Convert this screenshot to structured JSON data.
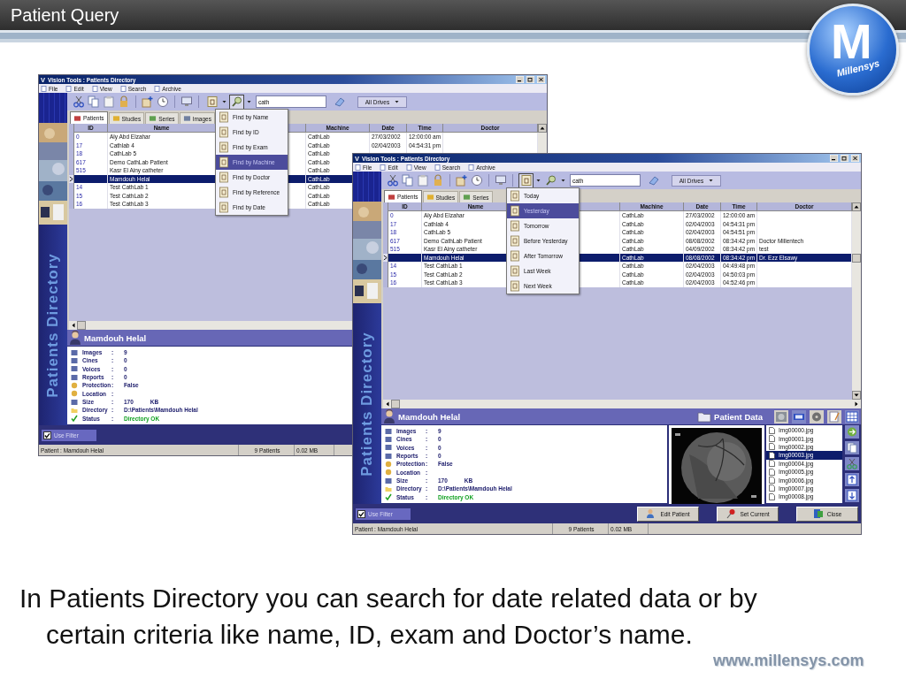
{
  "slide": {
    "title": "Patient Query",
    "logo": {
      "letter": "M",
      "name": "Millensys"
    }
  },
  "windows": [
    {
      "title": "Vision Tools : Patients Directory",
      "app_letter": "V",
      "menu": [
        "File",
        "Edit",
        "View",
        "Search",
        "Archive"
      ],
      "search_value": "cath",
      "drive": "All Drives",
      "tabs": [
        {
          "label": "Patients",
          "selected": true
        },
        {
          "label": "Studies",
          "selected": false
        },
        {
          "label": "Series",
          "selected": false
        },
        {
          "label": "Images",
          "selected": false
        }
      ],
      "sidebar_label": "Patients Directory",
      "columns": [
        "ID",
        "Name",
        "Machine",
        "Date",
        "Time",
        "Doctor"
      ],
      "rows": [
        {
          "id": "0",
          "name": "Aly Abd Elzahar",
          "machine": "CathLab",
          "date": "27/03/2002",
          "time": "12:00:00 am",
          "selected": false
        },
        {
          "id": "17",
          "name": "Cathlab 4",
          "machine": "CathLab",
          "date": "02/04/2003",
          "time": "04:54:31 pm",
          "selected": false
        },
        {
          "id": "18",
          "name": "CathLab 5",
          "machine": "CathLab",
          "selected": false
        },
        {
          "id": "617",
          "name": "Demo CathLab Patient",
          "machine": "CathLab",
          "selected": false
        },
        {
          "id": "515",
          "name": "Kasr El Ainy catheter",
          "machine": "CathLab",
          "selected": false
        },
        {
          "name": "Mamdouh Helal",
          "machine": "CathLab",
          "selected": true
        },
        {
          "id": "14",
          "name": "Test CathLab 1",
          "machine": "CathLab",
          "selected": false
        },
        {
          "id": "15",
          "name": "Test CathLab 2",
          "machine": "CathLab",
          "selected": false
        },
        {
          "id": "16",
          "name": "Test CathLab 3",
          "machine": "CathLab",
          "selected": false
        }
      ],
      "dropdown": {
        "kind": "find",
        "items": [
          {
            "label": "Find by Name",
            "selected": false
          },
          {
            "label": "Find by ID",
            "selected": false
          },
          {
            "label": "Find by Exam",
            "selected": false
          },
          {
            "label": "Find by Machine",
            "selected": true
          },
          {
            "label": "Find by Doctor",
            "selected": false
          },
          {
            "label": "Find by Reference",
            "selected": false
          },
          {
            "label": "Find by Date",
            "selected": false
          }
        ]
      },
      "patient": {
        "name": "Mamdouh Helal",
        "fields": [
          {
            "kind": "images",
            "label": "Images",
            "sep": ":",
            "value": "9"
          },
          {
            "kind": "cines",
            "label": "Cines",
            "sep": ":",
            "value": "0"
          },
          {
            "kind": "voices",
            "label": "Voices",
            "sep": ":",
            "value": "0"
          },
          {
            "kind": "reports",
            "label": "Reports",
            "sep": ":",
            "value": "0"
          },
          {
            "kind": "protection",
            "label": "Protection",
            "sep": ":",
            "value": "False"
          },
          {
            "kind": "location",
            "label": "Location",
            "sep": ":"
          },
          {
            "kind": "size",
            "label": "Size",
            "sep": ":",
            "value": "170",
            "unit": "KB"
          },
          {
            "kind": "directory",
            "label": "Directory",
            "sep": ":",
            "value": "D:\\Patients\\Mamdouh Helal"
          },
          {
            "kind": "status",
            "label": "Status",
            "sep": ":",
            "value": "Directory OK"
          }
        ]
      },
      "use_filter": {
        "label": "Use Filter",
        "checked": true
      },
      "status": [
        "Patient : Mamdouh Helal",
        "9 Patients",
        "0.02 MB"
      ]
    },
    {
      "title": "Vision Tools : Patients Directory",
      "app_letter": "V",
      "menu": [
        "File",
        "Edit",
        "View",
        "Search",
        "Archive"
      ],
      "search_value": "cath",
      "drive": "All Drives",
      "tabs": [
        {
          "label": "Patients",
          "selected": true
        },
        {
          "label": "Studies",
          "selected": false
        },
        {
          "label": "Series",
          "selected": false
        }
      ],
      "sidebar_label": "Patients Directory",
      "columns": [
        "ID",
        "Name",
        "Machine",
        "Date",
        "Time",
        "Doctor"
      ],
      "rows": [
        {
          "id": "0",
          "name": "Aly Abd Elzahar",
          "machine": "CathLab",
          "date": "27/03/2002",
          "time": "12:00:00 am",
          "selected": false
        },
        {
          "id": "17",
          "name": "Cathlab 4",
          "machine": "CathLab",
          "date": "02/04/2003",
          "time": "04:54:31 pm",
          "selected": false
        },
        {
          "id": "18",
          "name": "CathLab 5",
          "machine": "CathLab",
          "date": "02/04/2003",
          "time": "04:54:51 pm",
          "selected": false
        },
        {
          "id": "617",
          "name": "Demo CathLab Patient",
          "machine": "CathLab",
          "date": "08/08/2002",
          "time": "08:34:42 pm",
          "doctor": "Doctor Millentech",
          "selected": false
        },
        {
          "id": "515",
          "name": "Kasr El Ainy catheter",
          "machine": "CathLab",
          "date": "04/09/2002",
          "time": "08:34:42 pm",
          "doctor": "test",
          "selected": false
        },
        {
          "name": "Mamdouh Helal",
          "machine": "CathLab",
          "date": "08/08/2002",
          "time": "08:34:42 pm",
          "doctor": "Dr. Ezz Elsawy",
          "selected": true
        },
        {
          "id": "14",
          "name": "Test CathLab 1",
          "machine": "CathLab",
          "date": "02/04/2003",
          "time": "04:49:48 pm",
          "selected": false
        },
        {
          "id": "15",
          "name": "Test CathLab 2",
          "machine": "CathLab",
          "date": "02/04/2003",
          "time": "04:50:03 pm",
          "selected": false
        },
        {
          "id": "16",
          "name": "Test CathLab 3",
          "machine": "CathLab",
          "date": "02/04/2003",
          "time": "04:52:46 pm",
          "selected": false
        }
      ],
      "dropdown": {
        "kind": "date",
        "items": [
          {
            "label": "Today",
            "selected": false
          },
          {
            "label": "Yesterday",
            "selected": true
          },
          {
            "label": "Tomorrow",
            "selected": false
          },
          {
            "label": "Before Yesterday",
            "selected": false
          },
          {
            "label": "After Tomorrow",
            "selected": false
          },
          {
            "label": "Last Week",
            "selected": false
          },
          {
            "label": "Next Week",
            "selected": false
          }
        ]
      },
      "patient": {
        "name": "Mamdouh Helal",
        "fields": [
          {
            "kind": "images",
            "label": "Images",
            "sep": ":",
            "value": "9"
          },
          {
            "kind": "cines",
            "label": "Cines",
            "sep": ":",
            "value": "0"
          },
          {
            "kind": "voices",
            "label": "Voices",
            "sep": ":",
            "value": "0"
          },
          {
            "kind": "reports",
            "label": "Reports",
            "sep": ":",
            "value": "0"
          },
          {
            "kind": "protection",
            "label": "Protection",
            "sep": ":",
            "value": "False"
          },
          {
            "kind": "location",
            "label": "Location",
            "sep": ":"
          },
          {
            "kind": "size",
            "label": "Size",
            "sep": ":",
            "value": "170",
            "unit": "KB"
          },
          {
            "kind": "directory",
            "label": "Directory",
            "sep": ":",
            "value": "D:\\Patients\\Mamdouh Helal"
          },
          {
            "kind": "status",
            "label": "Status",
            "sep": ":",
            "value": "Directory OK"
          }
        ]
      },
      "patient_data": {
        "title": "Patient Data",
        "files": [
          {
            "name": "Img00000.jpg",
            "selected": false
          },
          {
            "name": "Img00001.jpg",
            "selected": false
          },
          {
            "name": "Img00002.jpg",
            "selected": false
          },
          {
            "name": "Img00003.jpg",
            "selected": true
          },
          {
            "name": "Img00004.jpg",
            "selected": false
          },
          {
            "name": "Img00005.jpg",
            "selected": false
          },
          {
            "name": "Img00006.jpg",
            "selected": false
          },
          {
            "name": "Img00007.jpg",
            "selected": false
          },
          {
            "name": "Img00008.jpg",
            "selected": false
          }
        ]
      },
      "buttons": [
        "Edit Patient",
        "Set Current",
        "Close"
      ],
      "use_filter": {
        "label": "Use Filter",
        "checked": true
      },
      "status": [
        "Patient : Mamdouh Helal",
        "9 Patients",
        "0.02 MB"
      ]
    }
  ],
  "caption": "In Patients Directory you can search for date related data or by certain criteria like name, ID, exam and Doctor’s name.",
  "footer": "www.millensys.com"
}
